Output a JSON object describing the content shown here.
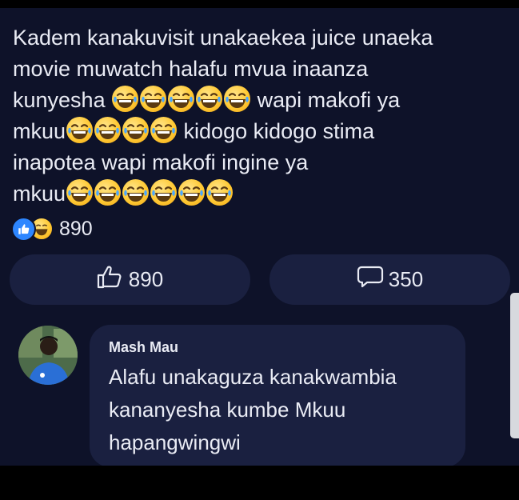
{
  "post": {
    "lines": [
      "Kadem kanakuvisit unakaekea juice unaeka",
      "movie muwatch halafu mvua inaanza",
      "kunyesha",
      "wapi makofi ya",
      "mkuu",
      "kidogo kidogo stima",
      "inapotea wapi makofi ingine ya",
      "mkuu"
    ],
    "emoji_name": "tears-of-joy-emoji"
  },
  "reactions": {
    "count": "890",
    "icons": [
      "like-icon",
      "laughing-icon"
    ],
    "like_color": "#2d86ff"
  },
  "actions": {
    "like_count": "890",
    "comment_count": "350",
    "like_icon": "thumbs-up-outline-icon",
    "comment_icon": "speech-bubble-icon"
  },
  "comment": {
    "author": "Mash Mau",
    "lines": [
      "Alafu unakaguza kanakwambia",
      "kananyesha kumbe Mkuu",
      "hapangwingwi"
    ]
  },
  "colors": {
    "background": "#0e1229",
    "surface": "#1a2040",
    "text": "#e9ebf4"
  }
}
